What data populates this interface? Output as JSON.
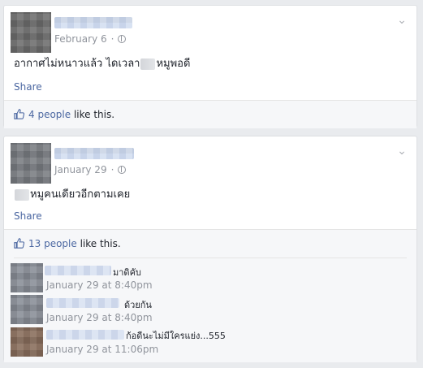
{
  "post1": {
    "timestamp": "February 6",
    "dot": "·",
    "text_part1": "อากาศไม่หนาวแล้ว ไดเวลา",
    "text_part2": "หมูพอดี",
    "share": "Share",
    "likes_count": "4 people",
    "likes_suffix": " like this."
  },
  "post2": {
    "timestamp": "January 29",
    "dot": "·",
    "text": "หมูคนเดียวอีกตามเคย",
    "share": "Share",
    "likes_count": "13 people",
    "likes_suffix": " like this.",
    "comments": [
      {
        "text": "มาดิคับ",
        "time": "January 29 at 8:40pm"
      },
      {
        "text": "ด้วยกัน",
        "time": "January 29 at 8:40pm"
      },
      {
        "text": "ก้อดีนะไม่มีใครแย่ง...555",
        "time": "January 29 at 11:06pm"
      }
    ]
  },
  "icons": {
    "chevron": "chevron-down-icon",
    "globe": "globe-icon",
    "like": "thumbs-up-icon"
  },
  "colors": {
    "link": "#4b67a1",
    "muted": "#90949c",
    "background": "#e9ebee"
  }
}
